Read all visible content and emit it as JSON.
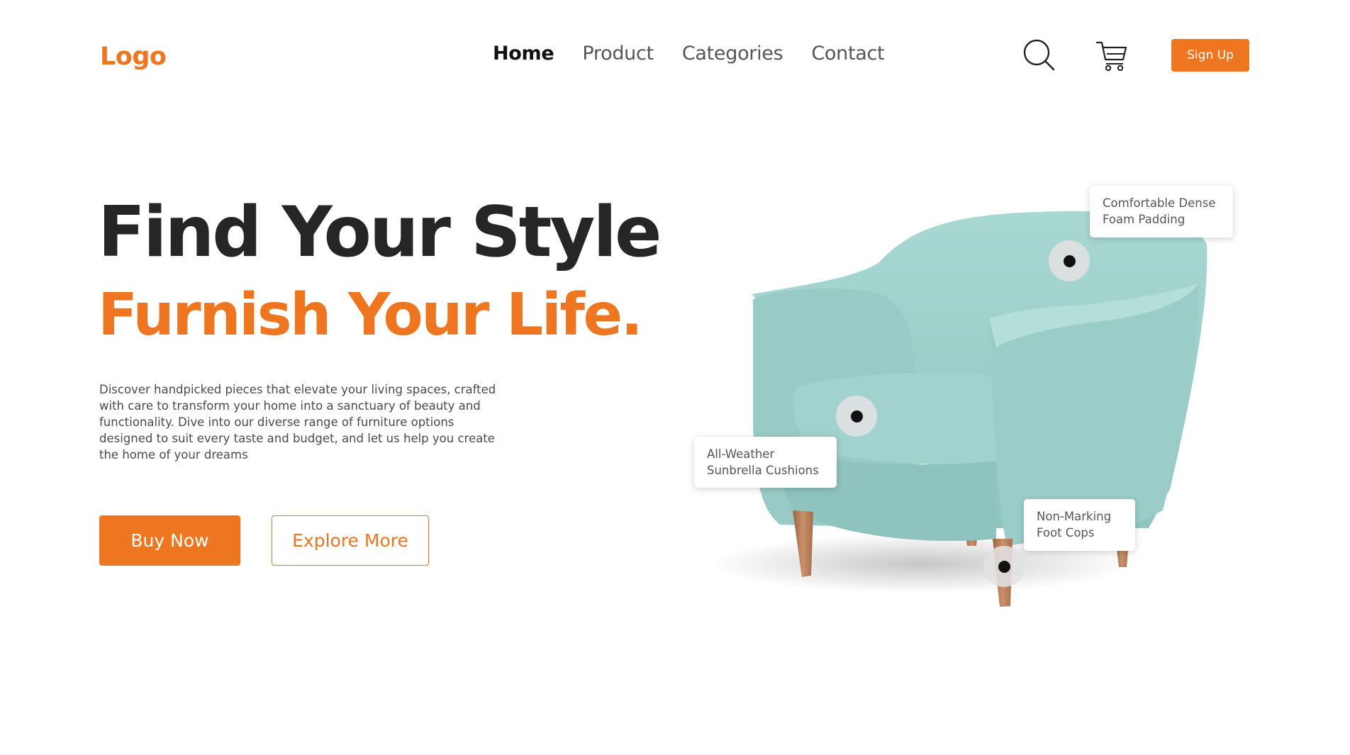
{
  "header": {
    "logo": "Logo",
    "nav": [
      {
        "label": "Home",
        "active": true
      },
      {
        "label": "Product",
        "active": false
      },
      {
        "label": "Categories",
        "active": false
      },
      {
        "label": "Contact",
        "active": false
      }
    ],
    "icons": [
      "search-icon",
      "cart-icon"
    ],
    "signup_label": "Sign Up"
  },
  "hero": {
    "title": "Find Your Style",
    "subtitle": "Furnish Your Life.",
    "description": "Discover handpicked pieces that elevate your living spaces, crafted with care to transform your home into a sanctuary of beauty and functionality. Dive into our diverse range of furniture options designed to suit every taste and budget, and let us help you create the home of your dreams",
    "buy_label": "Buy Now",
    "explore_label": "Explore More"
  },
  "product": {
    "image": "armchair-image",
    "features": [
      {
        "line1": "Comfortable Dense",
        "line2": "Foam Padding"
      },
      {
        "line1": "All-Weather",
        "line2": "Sunbrella Cushions"
      },
      {
        "line1": "Non-Marking",
        "line2": "Foot Cops"
      }
    ]
  },
  "colors": {
    "accent": "#EE7620",
    "chair": "#9CCFCA",
    "heading": "#262626",
    "wood": "#B87E58"
  }
}
